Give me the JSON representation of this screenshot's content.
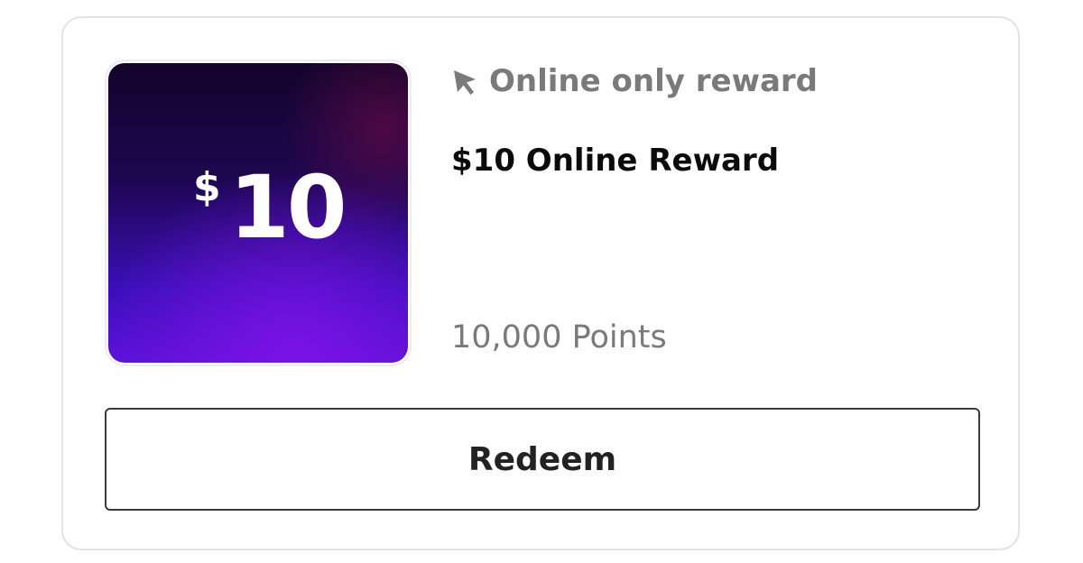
{
  "reward": {
    "badge_icon": "cursor-arrow-icon",
    "badge_label": "Online only reward",
    "image_currency": "$",
    "image_amount": "10",
    "title": "$10 Online Reward",
    "points": "10,000 Points"
  },
  "actions": {
    "redeem_label": "Redeem"
  },
  "colors": {
    "card_border": "#e3e3e3",
    "muted_text": "#7a7a7a",
    "title_text": "#0b0b0b",
    "button_border": "#3a3a3a",
    "image_gradient_top": "#13042a",
    "image_gradient_bottom": "#5a12d8"
  }
}
